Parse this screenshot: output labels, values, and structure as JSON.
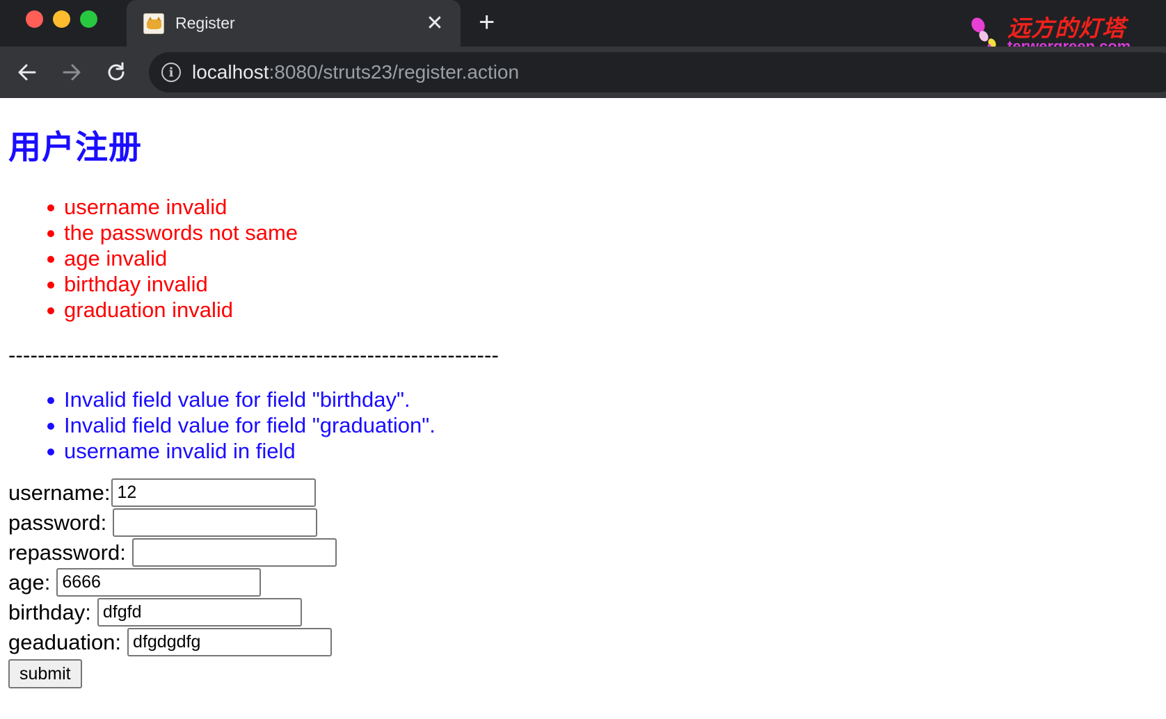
{
  "browser": {
    "tab_title": "Register",
    "url_host": "localhost",
    "url_rest": ":8080/struts23/register.action",
    "watermark_cn": "远方的灯塔",
    "watermark_en": "terwergreen.com"
  },
  "page": {
    "title": "用户注册",
    "action_errors": [
      "username invalid",
      "the passwords not same",
      "age invalid",
      "birthday invalid",
      "graduation invalid"
    ],
    "divider": "-------------------------------------------------------------------",
    "field_errors": [
      "Invalid field value for field \"birthday\".",
      "Invalid field value for field \"graduation\".",
      "username invalid in field"
    ],
    "form": {
      "username_label": "username:",
      "username_value": "12",
      "password_label": "password:",
      "password_value": "",
      "repassword_label": "repassword:",
      "repassword_value": "",
      "age_label": "age:",
      "age_value": "6666",
      "birthday_label": "birthday:",
      "birthday_value": "dfgfd",
      "geaduation_label": "geaduation:",
      "geaduation_value": "dfgdgdfg",
      "submit_label": "submit"
    }
  },
  "colors": {
    "heading": "#1a0dff",
    "action_error": "#ff0000",
    "field_error": "#1a0dff"
  },
  "icons": {
    "back": "arrow-left-icon",
    "forward": "arrow-right-icon",
    "reload": "reload-icon",
    "info": "info-icon",
    "close_tab": "close-icon",
    "new_tab": "plus-icon"
  }
}
